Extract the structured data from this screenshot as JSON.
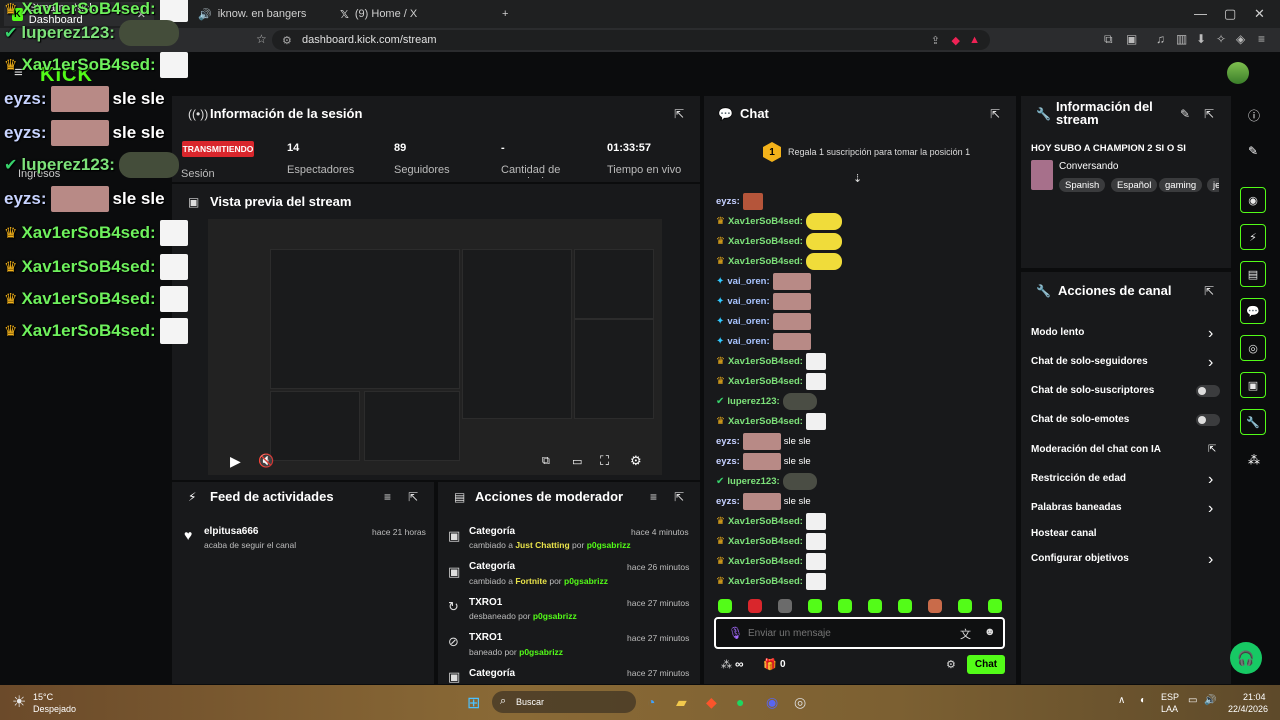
{
  "browser": {
    "tabs": [
      {
        "title": "Stream - Kick Dashboard"
      },
      {
        "title": "iknow. en bangers"
      },
      {
        "title": "(9) Home / X"
      }
    ],
    "new_tab": "+",
    "url": "dashboard.kick.com/stream"
  },
  "app": {
    "logo": "KICK"
  },
  "overlay": [
    {
      "name": "Xav1erSoB4sed:",
      "badge": "crown",
      "emote": "white"
    },
    {
      "name": "luperez123:",
      "badge": "check",
      "emote": "green"
    },
    {
      "name": "Xav1erSoB4sed:",
      "badge": "crown",
      "emote": "white"
    },
    {
      "name": "eyzs:",
      "text": "sle sle",
      "emote": "pink"
    },
    {
      "name": "eyzs:",
      "text": "sle sle",
      "emote": "pink"
    },
    {
      "name": "luperez123:",
      "badge": "check",
      "emote": "green"
    },
    {
      "name": "eyzs:",
      "text": "sle sle",
      "emote": "pink"
    },
    {
      "name": "Xav1erSoB4sed:",
      "badge": "crown",
      "emote": "white"
    },
    {
      "name": "Xav1erSoB4sed:",
      "badge": "crown",
      "emote": "white"
    },
    {
      "name": "Xav1erSoB4sed:",
      "badge": "crown",
      "emote": "white"
    },
    {
      "name": "Xav1erSoB4sed:",
      "badge": "crown",
      "emote": "white"
    }
  ],
  "leftnav": {
    "ingresos": "Ingresos"
  },
  "session": {
    "title": "Información de la sesión",
    "status": "TRANSMITIENDO",
    "status_label": "Sesión",
    "stats": [
      {
        "value": "14",
        "label": "Espectadores"
      },
      {
        "value": "89",
        "label": "Seguidores"
      },
      {
        "value": "-",
        "label": "Cantidad de suscripciones"
      },
      {
        "value": "01:33:57",
        "label": "Tiempo en vivo"
      }
    ]
  },
  "preview": {
    "title": "Vista previa del stream"
  },
  "feed": {
    "title": "Feed de actividades",
    "items": [
      {
        "user": "elpitusa666",
        "action": "acaba de seguir el canal",
        "time": "hace 21 horas"
      }
    ]
  },
  "modactions": {
    "title": "Acciones de moderador",
    "items": [
      {
        "title": "Categoría",
        "pre": "cambiado a",
        "target": "Just Chatting",
        "by": "por",
        "mod": "p0gsabrizz",
        "time": "hace 4 minutos"
      },
      {
        "title": "Categoría",
        "pre": "cambiado a",
        "target": "Fortnite",
        "by": "por",
        "mod": "p0gsabrizz",
        "time": "hace 26 minutos"
      },
      {
        "title": "TXRO1",
        "pre": "desbaneado por",
        "mod": "p0gsabrizz",
        "time": "hace 27 minutos"
      },
      {
        "title": "TXRO1",
        "pre": "baneado por",
        "mod": "p0gsabrizz",
        "time": "hace 27 minutos"
      },
      {
        "title": "Categoría",
        "time": "hace 27 minutos"
      }
    ]
  },
  "chat": {
    "title": "Chat",
    "gift_banner": "Regala 1 suscripción para tomar la posición 1",
    "gift_rank": "1",
    "messages": [
      {
        "name": "eyzs:",
        "badge": "",
        "emote": "e5"
      },
      {
        "name": "Xav1erSoB4sed:",
        "badge": "crown",
        "emote": "e4"
      },
      {
        "name": "Xav1erSoB4sed:",
        "badge": "crown",
        "emote": "e4"
      },
      {
        "name": "Xav1erSoB4sed:",
        "badge": "crown",
        "emote": "e4"
      },
      {
        "name": "vai_oren:",
        "badge": "ver",
        "emote": "e2"
      },
      {
        "name": "vai_oren:",
        "badge": "ver",
        "emote": "e2"
      },
      {
        "name": "vai_oren:",
        "badge": "ver",
        "emote": "e2"
      },
      {
        "name": "vai_oren:",
        "badge": "ver",
        "emote": "e2"
      },
      {
        "name": "Xav1erSoB4sed:",
        "badge": "crown",
        "emote": "e1"
      },
      {
        "name": "Xav1erSoB4sed:",
        "badge": "crown",
        "emote": "e1"
      },
      {
        "name": "luperez123:",
        "badge": "chk",
        "emote": "e3"
      },
      {
        "name": "Xav1erSoB4sed:",
        "badge": "crown",
        "emote": "e1"
      },
      {
        "name": "eyzs:",
        "badge": "",
        "emote": "e2",
        "text": "sle sle"
      },
      {
        "name": "eyzs:",
        "badge": "",
        "emote": "e2",
        "text": "sle sle"
      },
      {
        "name": "luperez123:",
        "badge": "chk",
        "emote": "e3"
      },
      {
        "name": "eyzs:",
        "badge": "",
        "emote": "e2",
        "text": "sle sle"
      },
      {
        "name": "Xav1erSoB4sed:",
        "badge": "crown",
        "emote": "e1"
      },
      {
        "name": "Xav1erSoB4sed:",
        "badge": "crown",
        "emote": "e1"
      },
      {
        "name": "Xav1erSoB4sed:",
        "badge": "crown",
        "emote": "e1"
      },
      {
        "name": "Xav1erSoB4sed:",
        "badge": "crown",
        "emote": "e1"
      }
    ],
    "input_placeholder": "Enviar un mensaje",
    "points": "∞",
    "gift_count": "0",
    "send_label": "Chat"
  },
  "streaminfo": {
    "title": "Información del stream",
    "stream_title": "HOY SUBO A CHAMPION 2 SI O SI",
    "category": "Conversando",
    "tags": [
      "Spanish",
      "Español",
      "gaming",
      "je"
    ]
  },
  "channel": {
    "title": "Acciones de canal",
    "rows": [
      {
        "label": "Modo lento",
        "ctrl": "chev"
      },
      {
        "label": "Chat de solo-seguidores",
        "ctrl": "chev"
      },
      {
        "label": "Chat de solo-suscriptores",
        "ctrl": "toggle"
      },
      {
        "label": "Chat de solo-emotes",
        "ctrl": "toggle"
      },
      {
        "label": "Moderación del chat con IA",
        "ctrl": "ext"
      },
      {
        "label": "Restricción de edad",
        "ctrl": "chev"
      },
      {
        "label": "Palabras baneadas",
        "ctrl": "chev"
      },
      {
        "label": "Hostear canal",
        "ctrl": "none"
      },
      {
        "label": "Configurar objetivos",
        "ctrl": "chev"
      }
    ]
  },
  "taskbar": {
    "weather_temp": "15°C",
    "weather_desc": "Despejado",
    "search": "Buscar",
    "lang": "ESP",
    "lang2": "LAA",
    "time": "21:04",
    "date": "22/4/2026"
  },
  "colors": {
    "accent": "#53fc18",
    "live": "#d9262c",
    "crown": "#f3b21a"
  }
}
